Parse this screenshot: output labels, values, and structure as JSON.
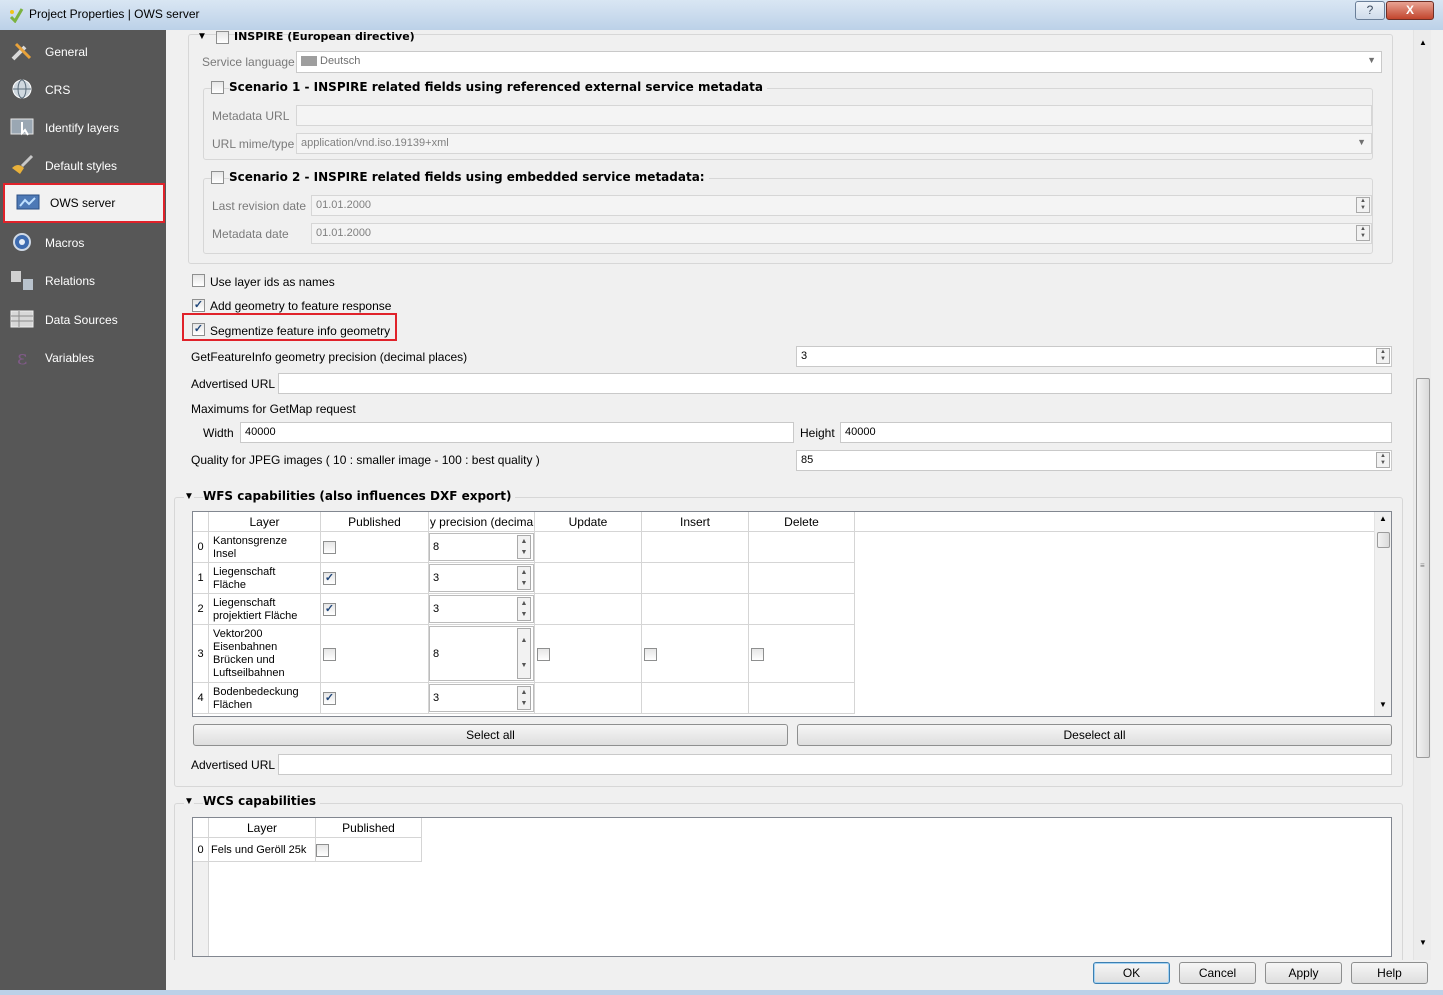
{
  "window": {
    "title": "Project Properties | OWS server",
    "help_btn": "?",
    "close_btn": "X"
  },
  "sidebar": {
    "items": [
      {
        "label": "General"
      },
      {
        "label": "CRS"
      },
      {
        "label": "Identify layers"
      },
      {
        "label": "Default styles"
      },
      {
        "label": "OWS server"
      },
      {
        "label": "Macros"
      },
      {
        "label": "Relations"
      },
      {
        "label": "Data Sources"
      },
      {
        "label": "Variables"
      }
    ]
  },
  "inspire": {
    "title": "INSPIRE (European directive)",
    "service_language_label": "Service language",
    "service_language_value": "Deutsch",
    "scenario1_title": "Scenario 1 - INSPIRE related fields using referenced external service metadata",
    "metadata_url_label": "Metadata URL",
    "metadata_url_value": "",
    "url_mime_label": "URL mime/type",
    "url_mime_value": "application/vnd.iso.19139+xml",
    "scenario2_title": "Scenario 2 - INSPIRE related fields using embedded service metadata:",
    "last_revision_label": "Last revision date",
    "last_revision_value": "01.01.2000",
    "metadata_date_label": "Metadata date",
    "metadata_date_value": "01.01.2000"
  },
  "wms": {
    "use_layer_ids_label": "Use layer ids as names",
    "add_geometry_label": "Add geometry to feature response",
    "segmentize_label": "Segmentize feature info geometry",
    "precision_label": "GetFeatureInfo geometry precision (decimal places)",
    "precision_value": "3",
    "advertised_url_label": "Advertised URL",
    "advertised_url_value": "",
    "maximums_label": "Maximums for GetMap request",
    "width_label": "Width",
    "width_value": "40000",
    "height_label": "Height",
    "height_value": "40000",
    "jpeg_quality_label": "Quality for JPEG images ( 10 : smaller image - 100 : best quality )",
    "jpeg_quality_value": "85"
  },
  "wfs": {
    "title": "WFS capabilities (also influences DXF export)",
    "columns": [
      "Layer",
      "Published",
      "y precision (decima",
      "Update",
      "Insert",
      "Delete"
    ],
    "rows": [
      {
        "no": "0",
        "layer": [
          "Kantonsgrenze",
          "Insel"
        ],
        "published": false,
        "precision": "8",
        "update": "",
        "insert": "",
        "delete": ""
      },
      {
        "no": "1",
        "layer": [
          "Liegenschaft",
          "Fläche"
        ],
        "published": true,
        "precision": "3",
        "update": "",
        "insert": "",
        "delete": ""
      },
      {
        "no": "2",
        "layer": [
          "Liegenschaft",
          "projektiert Fläche"
        ],
        "published": true,
        "precision": "3",
        "update": "",
        "insert": "",
        "delete": ""
      },
      {
        "no": "3",
        "layer": [
          "Vektor200",
          "Eisenbahnen",
          "Brücken und",
          "Luftseilbahnen"
        ],
        "published": false,
        "precision": "8",
        "update": false,
        "insert": false,
        "delete": false
      },
      {
        "no": "4",
        "layer": [
          "Bodenbedeckung",
          "Flächen"
        ],
        "published": true,
        "precision": "3",
        "update": "",
        "insert": "",
        "delete": ""
      }
    ],
    "select_all": "Select all",
    "deselect_all": "Deselect all",
    "advertised_url_label": "Advertised URL",
    "advertised_url_value": ""
  },
  "wcs": {
    "title": "WCS capabilities",
    "columns": [
      "Layer",
      "Published"
    ],
    "rows": [
      {
        "no": "0",
        "layer": "Fels und Geröll 25k",
        "published": false
      }
    ]
  },
  "buttons": {
    "ok": "OK",
    "cancel": "Cancel",
    "apply": "Apply",
    "help": "Help"
  }
}
